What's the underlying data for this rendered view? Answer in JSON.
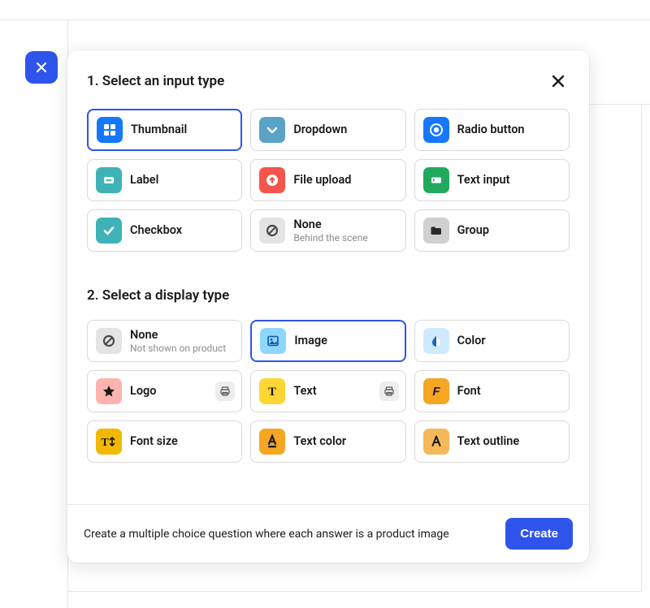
{
  "sections": {
    "input_title": "1. Select an input type",
    "display_title": "2. Select a display type"
  },
  "input_types": [
    {
      "label": "Thumbnail",
      "sub": "",
      "selected": true
    },
    {
      "label": "Dropdown",
      "sub": "",
      "selected": false
    },
    {
      "label": "Radio button",
      "sub": "",
      "selected": false
    },
    {
      "label": "Label",
      "sub": "",
      "selected": false
    },
    {
      "label": "File upload",
      "sub": "",
      "selected": false
    },
    {
      "label": "Text input",
      "sub": "",
      "selected": false
    },
    {
      "label": "Checkbox",
      "sub": "",
      "selected": false
    },
    {
      "label": "None",
      "sub": "Behind the scene",
      "selected": false
    },
    {
      "label": "Group",
      "sub": "",
      "selected": false
    }
  ],
  "display_types": [
    {
      "label": "None",
      "sub": "Not shown on product",
      "selected": false
    },
    {
      "label": "Image",
      "sub": "",
      "selected": true
    },
    {
      "label": "Color",
      "sub": "",
      "selected": false
    },
    {
      "label": "Logo",
      "sub": "",
      "selected": false,
      "printer": true
    },
    {
      "label": "Text",
      "sub": "",
      "selected": false,
      "printer": true
    },
    {
      "label": "Font",
      "sub": "",
      "selected": false
    },
    {
      "label": "Font size",
      "sub": "",
      "selected": false
    },
    {
      "label": "Text color",
      "sub": "",
      "selected": false
    },
    {
      "label": "Text outline",
      "sub": "",
      "selected": false
    }
  ],
  "footer": {
    "description": "Create a multiple choice question where each answer is a product image",
    "create_label": "Create"
  }
}
